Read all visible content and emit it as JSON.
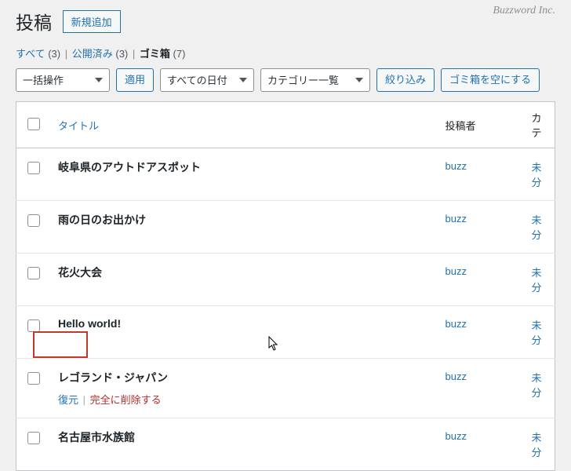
{
  "branding": "Buzzword Inc.",
  "header": {
    "title": "投稿",
    "addNew": "新規追加"
  },
  "filters": {
    "all": {
      "label": "すべて",
      "count": "(3)"
    },
    "published": {
      "label": "公開済み",
      "count": "(3)"
    },
    "trash": {
      "label": "ゴミ箱",
      "count": "(7)"
    }
  },
  "controls": {
    "bulkOption": "一括操作",
    "apply": "適用",
    "dateOption": "すべての日付",
    "catOption": "カテゴリー一覧",
    "filter": "絞り込み",
    "emptyTrash": "ゴミ箱を空にする"
  },
  "columns": {
    "title": "タイトル",
    "author": "投稿者",
    "category": "カテ"
  },
  "rowActions": {
    "restore": "復元",
    "delete": "完全に削除する"
  },
  "rows": [
    {
      "title": "岐阜県のアウトドアスポット",
      "author": "buzz",
      "cat": "未分"
    },
    {
      "title": "雨の日のお出かけ",
      "author": "buzz",
      "cat": "未分"
    },
    {
      "title": "花火大会",
      "author": "buzz",
      "cat": "未分"
    },
    {
      "title": "Hello world!",
      "author": "buzz",
      "cat": "未分"
    },
    {
      "title": "レゴランド・ジャパン",
      "author": "buzz",
      "cat": "未分",
      "showActions": true
    },
    {
      "title": "名古屋市水族館",
      "author": "buzz",
      "cat": "未分"
    }
  ]
}
